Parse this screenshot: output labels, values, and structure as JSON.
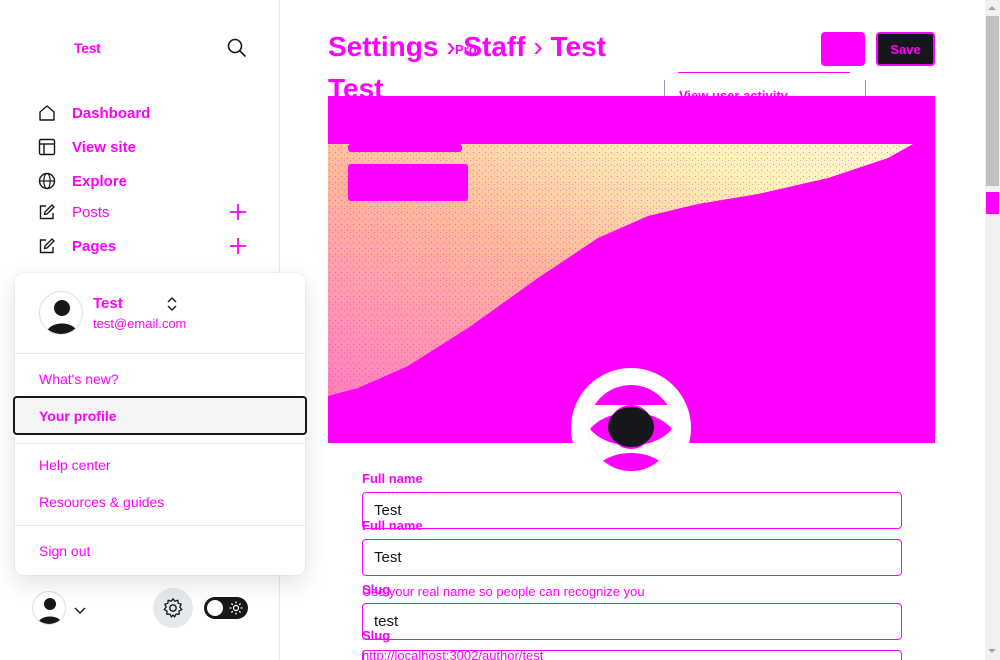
{
  "colors": {
    "accent": "#ff00ff",
    "dark": "#15171a"
  },
  "sidebar": {
    "site_title": "Test",
    "nav": [
      {
        "label": "Dashboard",
        "icon": "home-icon"
      },
      {
        "label": "View site",
        "icon": "layout-icon"
      },
      {
        "label": "Explore",
        "icon": "globe-icon"
      },
      {
        "label": "Posts",
        "icon": "pencil-square-icon",
        "add": true
      },
      {
        "label": "Pages",
        "icon": "pencil-square-icon",
        "add": true
      }
    ]
  },
  "user_menu": {
    "name": "Test",
    "email": "test@email.com",
    "items": {
      "whats_new": "What's new?",
      "your_profile": "Your profile",
      "help_center": "Help center",
      "resources": "Resources & guides",
      "sign_out": "Sign out"
    }
  },
  "header": {
    "breadcrumb": [
      "Settings",
      "Staff",
      "Test"
    ],
    "title_second_line": "Test",
    "overlay_text": "Pro",
    "save_label": "Save",
    "dropdown_item": "View user activity"
  },
  "form": {
    "full_name_label": "Full name",
    "full_name_value": "Test",
    "full_name_hint": "Use your real name so people can recognize you",
    "slug_label": "Slug",
    "slug_value": "test",
    "slug_url": "http://localhost:3002/author/test"
  }
}
